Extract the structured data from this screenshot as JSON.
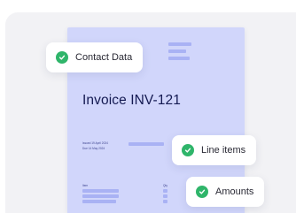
{
  "document": {
    "title": "Invoice INV-121",
    "issued_line": "Issued 19 April 2024",
    "due_line": "Due 14 May 2024",
    "items_header": "Item",
    "qty_header": "Qty"
  },
  "tags": {
    "contact": "Contact Data",
    "line_items": "Line items",
    "amounts": "Amounts"
  },
  "colors": {
    "document_background": "#d1d6fb",
    "placeholder_bar": "#a9b2f4",
    "check_green": "#2fb56a",
    "title_text": "#141a52"
  },
  "icons": {
    "tag_icon": "check-circle-icon"
  }
}
